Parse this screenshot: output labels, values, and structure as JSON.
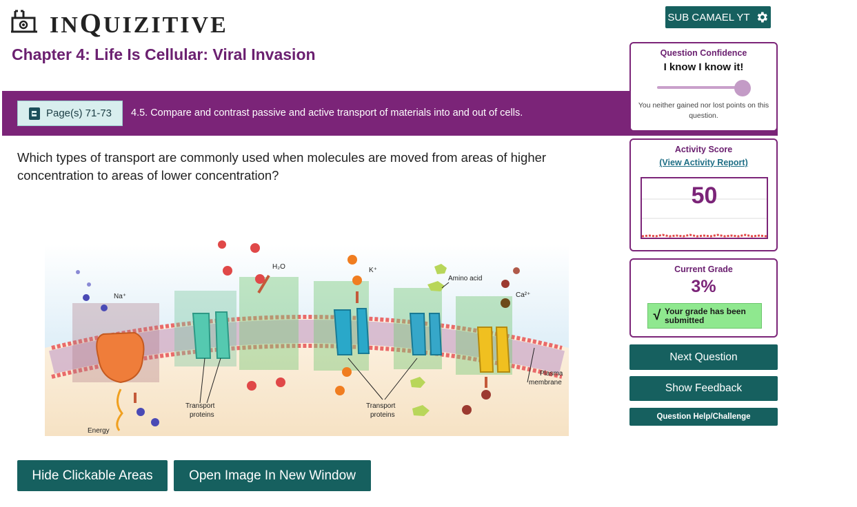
{
  "header": {
    "logo_text_big": "Q",
    "logo_text_prefix": "IN",
    "logo_text_suffix": "UIZITIVE",
    "user_label": "SUB CAMAEL YT",
    "chapter_title": "Chapter 4: Life Is Cellular: Viral Invasion"
  },
  "objective": {
    "pages_label": "Page(s) 71-73",
    "text": "4.5. Compare and contrast passive and active transport of materials into and out of cells."
  },
  "question": {
    "text": "Which types of transport are commonly used when molecules are moved from areas of higher concentration to areas of lower concentration?"
  },
  "figure": {
    "labels": {
      "na": "Na⁺",
      "water": "H₂O",
      "k": "K⁺",
      "amino": "Amino acid",
      "ca": "Ca²⁺",
      "energy": "Energy",
      "transport1_line1": "Transport",
      "transport1_line2": "proteins",
      "transport2_line1": "Transport",
      "transport2_line2": "proteins",
      "plasma_line1": "Plasma",
      "plasma_line2": "membrane"
    }
  },
  "buttons": {
    "hide_areas": "Hide Clickable Areas",
    "open_image": "Open Image In New Window",
    "next_question": "Next Question",
    "show_feedback": "Show Feedback",
    "help": "Question Help/Challenge"
  },
  "confidence": {
    "title": "Question Confidence",
    "value": "I know I know it!",
    "level": 1.0,
    "note": "You neither gained nor lost points on this question."
  },
  "activity": {
    "title": "Activity Score",
    "report_link": "(View Activity Report)",
    "score": "50"
  },
  "grade": {
    "title": "Current Grade",
    "value": "3%",
    "status": "Your grade has been submitted"
  },
  "colors": {
    "brand_purple": "#7b2478",
    "teal_button": "#16605f",
    "success_green": "#8fe88f"
  }
}
